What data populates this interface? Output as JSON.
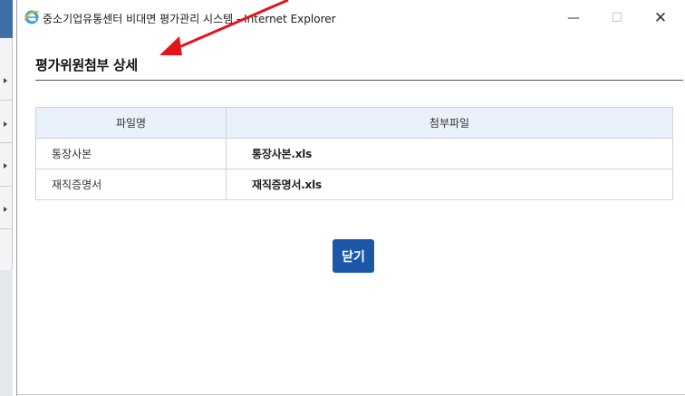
{
  "window": {
    "title": "중소기업유통센터 비대면 평가관리 시스템 - Internet Explorer",
    "controls": {
      "minimize": "—",
      "maximize": "☐",
      "close": "✕"
    }
  },
  "page": {
    "title": "평가위원첨부 상세"
  },
  "attachments": {
    "headers": [
      "파일명",
      "첨부파일"
    ],
    "rows": [
      {
        "name": "통장사본",
        "file": "통장사본.xls"
      },
      {
        "name": "재직증명서",
        "file": "재직증명서.xls"
      }
    ]
  },
  "actions": {
    "close_label": "닫기"
  },
  "colors": {
    "accent": "#1d57a8",
    "header_bg": "#eaf1fb",
    "annotation": "#e3141b"
  },
  "icons": [
    "ie-icon",
    "minimize-icon",
    "maximize-icon",
    "close-icon",
    "annotation-arrow"
  ]
}
